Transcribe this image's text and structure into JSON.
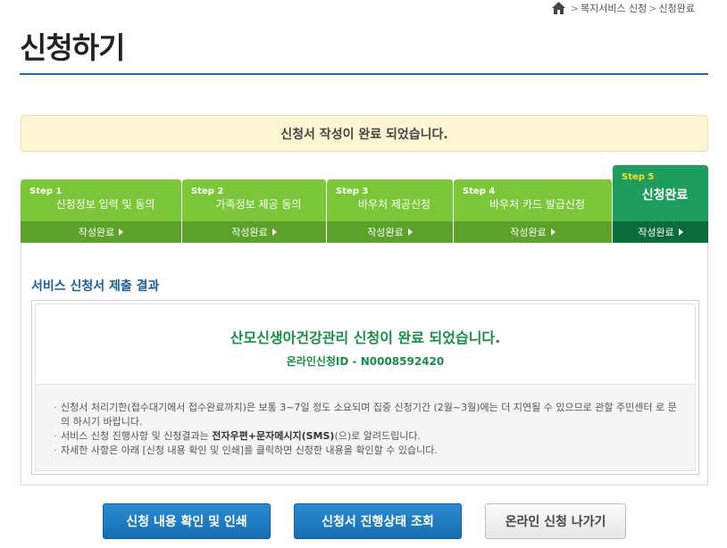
{
  "breadcrumb": {
    "home_icon": "home-icon",
    "items": [
      "복지서비스 신청",
      "신청완료"
    ],
    "separator": ">"
  },
  "page": {
    "title": "신청하기"
  },
  "notice": {
    "text": "신청서 작성이 완료 되었습니다."
  },
  "steps": [
    {
      "num": "Step 1",
      "label": "신청정보 입력 및 동의",
      "status": "작성완료"
    },
    {
      "num": "Step 2",
      "label": "가족정보 제공 동의",
      "status": "작성완료"
    },
    {
      "num": "Step 3",
      "label": "바우처 제공신청",
      "status": "작성완료"
    },
    {
      "num": "Step 4",
      "label": "바우처 카드 발급신청",
      "status": "작성완료"
    },
    {
      "num": "Step 5",
      "label": "신청완료",
      "status": "작성완료"
    }
  ],
  "result": {
    "section_title": "서비스 신청서 제출 결과",
    "headline": "산모신생아건강관리 신청이 완료 되었습니다.",
    "id_line": "온라인신청ID - N0008592420",
    "notes": [
      {
        "text": "신청서 처리기한(접수대기에서 접수완료까지)은 보통 3~7일 정도 소요되며 집중 신청기간 (2월~3월)에는 더 지연될 수 있으므로 관할 주민센터 로 문의 하시기 바랍니다."
      },
      {
        "pre": "서비스 신청 진행사항 및 신청결과는 ",
        "bold": "전자우편+문자메시지(SMS)",
        "post": "(으)로 알려드립니다."
      },
      {
        "text": "자세한 사항은 아래 [신청 내용 확인 및 인쇄]를 클릭하면 신청한 내용을 확인할 수 있습니다."
      }
    ]
  },
  "buttons": {
    "print": "신청 내용 확인 및 인쇄",
    "status": "신청서 진행상태 조회",
    "exit": "온라인 신청 나가기"
  },
  "colors": {
    "title_rule": "#1f6aa5",
    "step_green": "#7cc63a",
    "step_active": "#1e9d5d",
    "result_green": "#178f47",
    "button_blue": "#1f7cc0"
  }
}
